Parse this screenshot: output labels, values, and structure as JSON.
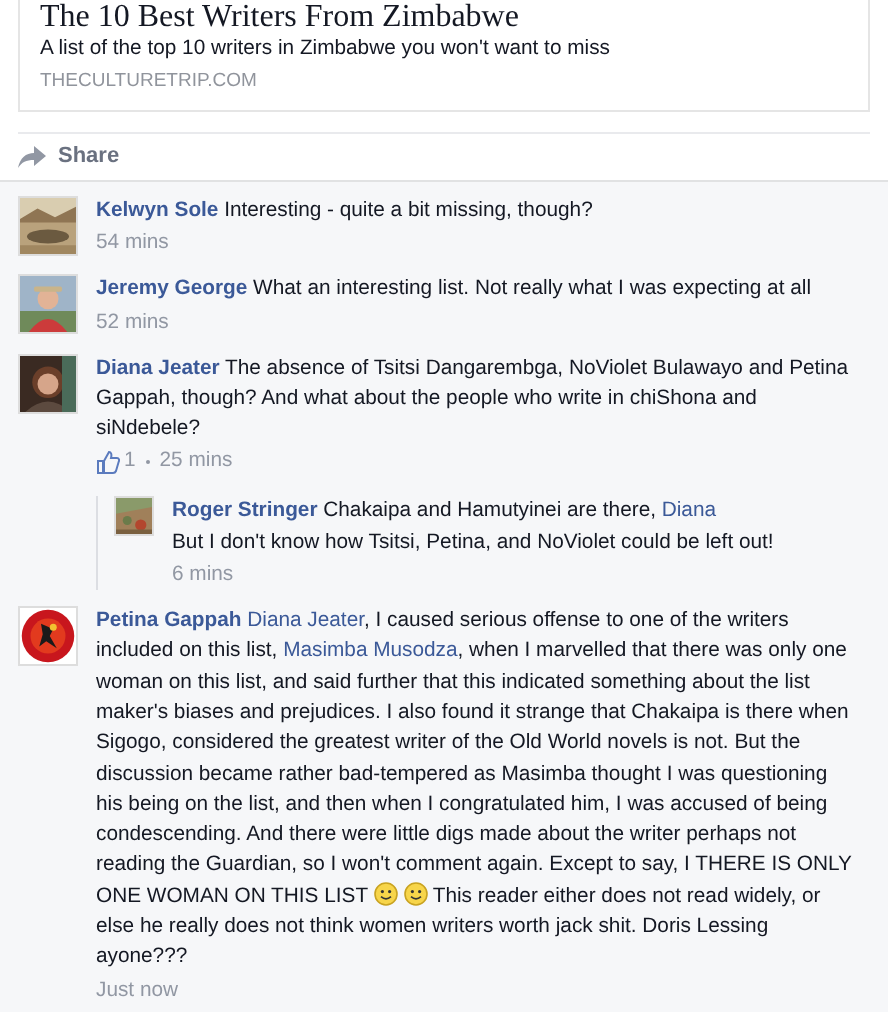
{
  "link_card": {
    "title": "The 10 Best Writers From Zimbabwe",
    "description": "A list of the top 10 writers in Zimbabwe you won't want to miss",
    "domain": "THECULTURETRIP.COM"
  },
  "share": {
    "label": "Share"
  },
  "comments": [
    {
      "author": "Kelwyn Sole",
      "body": [
        {
          "kind": "text",
          "text": "Interesting - quite a bit missing, though?"
        }
      ],
      "time": "54 mins"
    },
    {
      "author": "Jeremy George",
      "body": [
        {
          "kind": "text",
          "text": "What an interesting list. Not really what I was expecting at all"
        }
      ],
      "time": "52 mins"
    },
    {
      "author": "Diana Jeater",
      "body": [
        {
          "kind": "text",
          "text": "The absence of Tsitsi Dangarembga, NoViolet Bulawayo and Petina Gappah, though? And what about the people who write in chiShona and siNdebele?"
        }
      ],
      "likes": "1",
      "time": "25 mins",
      "replies": [
        {
          "author": "Roger Stringer",
          "body": [
            {
              "kind": "text",
              "text": "Chakaipa and Hamutyinei are there, "
            },
            {
              "kind": "link",
              "text": "Diana"
            },
            {
              "kind": "break"
            },
            {
              "kind": "text",
              "text": "But I don't know how Tsitsi, Petina, and NoViolet could be left out!"
            }
          ],
          "time": "6 mins"
        }
      ]
    },
    {
      "author": "Petina Gappah",
      "body": [
        {
          "kind": "link",
          "text": "Diana Jeater"
        },
        {
          "kind": "text",
          "text": ", I caused serious offense to one of the writers included on this list, "
        },
        {
          "kind": "link",
          "text": "Masimba Musodza"
        },
        {
          "kind": "text",
          "text": ", when I marvelled that there was only one woman on this list, and said further that this indicated something about the list maker's biases and prejudices. I also found it strange that Chakaipa is there when Sigogo, considered the greatest writer of the Old World novels is not. But the discussion became rather bad-tempered as Masimba thought I was questioning his being on the list, and then when I congratulated him, I was accused of being condescending. And there were little digs made about the writer perhaps not reading the Guardian, so I won't comment again. Except to say, I THERE IS ONLY ONE WOMAN ON THIS LIST "
        },
        {
          "kind": "emoji"
        },
        {
          "kind": "emoji"
        },
        {
          "kind": "text",
          "text": " This reader either does not read widely, or else he really does not think women writers worth jack shit. Doris Lessing ayone???"
        }
      ],
      "time": "Just now"
    }
  ]
}
